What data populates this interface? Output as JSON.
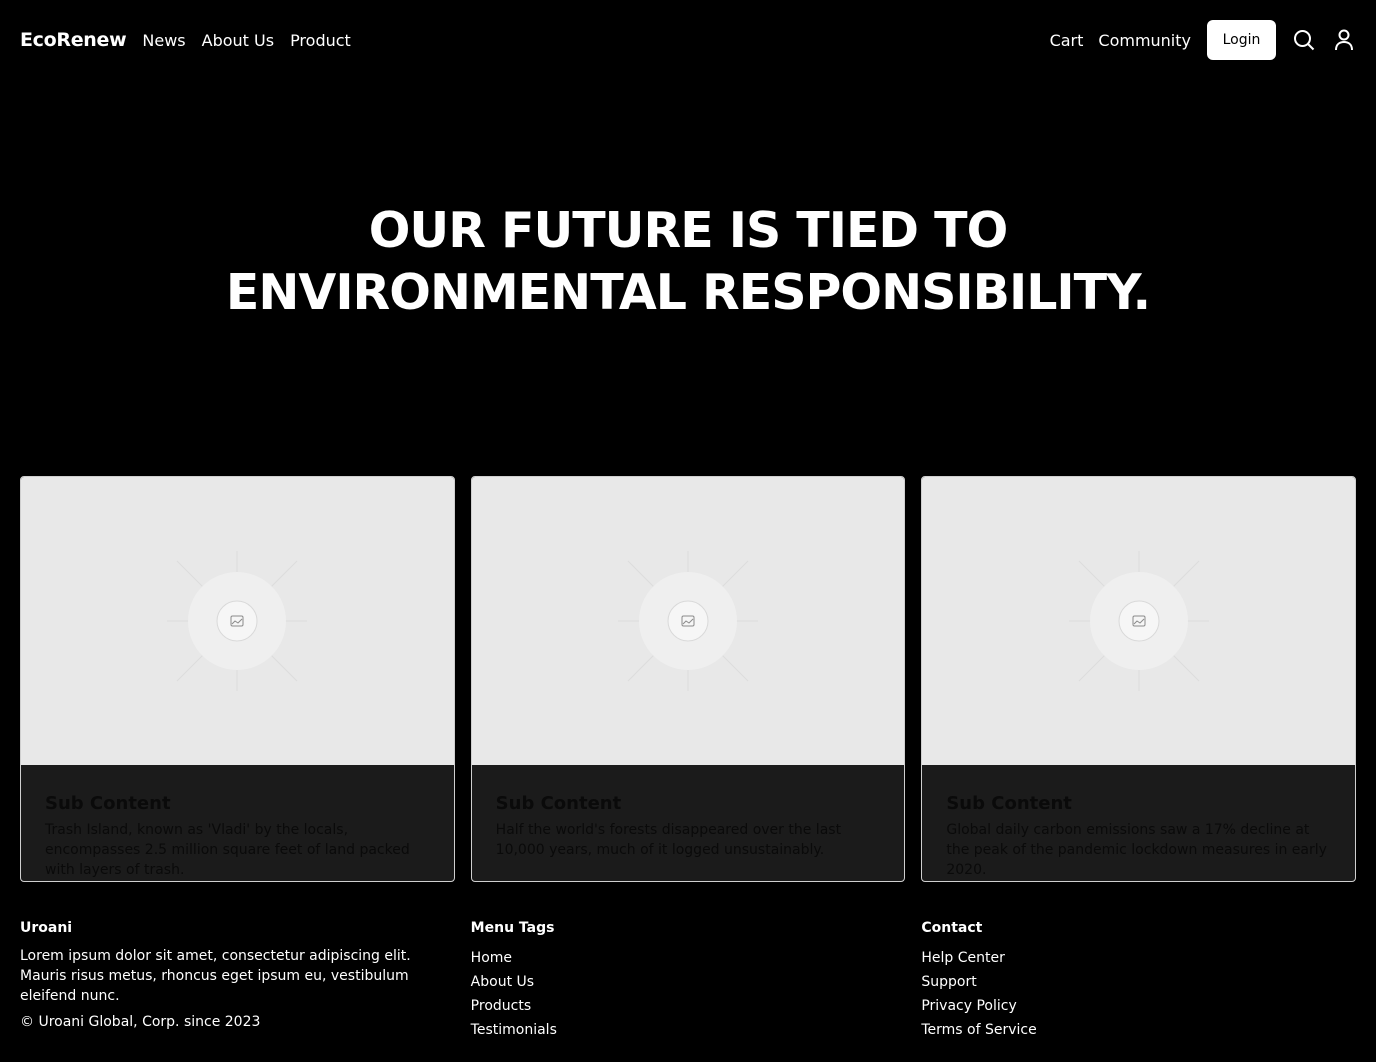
{
  "header": {
    "brand": "EcoRenew",
    "nav_left": [
      "News",
      "About Us",
      "Product"
    ],
    "nav_right": [
      "Cart",
      "Community"
    ],
    "login_label": "Login",
    "icons": [
      "search-icon",
      "user-icon"
    ]
  },
  "hero": {
    "title": "OUR FUTURE IS TIED TO ENVIRONMENTAL RESPONSIBILITY."
  },
  "cards": [
    {
      "image_icon": "image-placeholder-icon",
      "title": "Sub Content",
      "text": "Trash Island, known as 'Vladi' by the locals, encompasses 2.5 million square feet of land packed with layers of trash."
    },
    {
      "image_icon": "image-placeholder-icon",
      "title": "Sub Content",
      "text": "Half the world's forests disappeared over the last 10,000 years, much of it logged unsustainably."
    },
    {
      "image_icon": "image-placeholder-icon",
      "title": "Sub Content",
      "text": "Global daily carbon emissions saw a 17% decline at the peak of the pandemic lockdown measures in early 2020."
    }
  ],
  "footer": {
    "about": {
      "heading": "Uroani",
      "description": "Lorem ipsum dolor sit amet, consectetur adipiscing elit. Mauris risus metus, rhoncus eget ipsum eu, vestibulum eleifend nunc.",
      "copyright": "© Uroani Global, Corp. since 2023"
    },
    "menu": {
      "heading": "Menu Tags",
      "links": [
        "Home",
        "About Us",
        "Products",
        "Testimonials"
      ]
    },
    "contact": {
      "heading": "Contact",
      "links": [
        "Help Center",
        "Support",
        "Privacy Policy",
        "Terms of Service"
      ]
    }
  },
  "colors": {
    "background": "#000000",
    "text": "#ffffff",
    "card_image_bg": "#e8e8e8",
    "card_body_bg": "#1b1b1b",
    "card_body_text": "#0a0a0a"
  }
}
